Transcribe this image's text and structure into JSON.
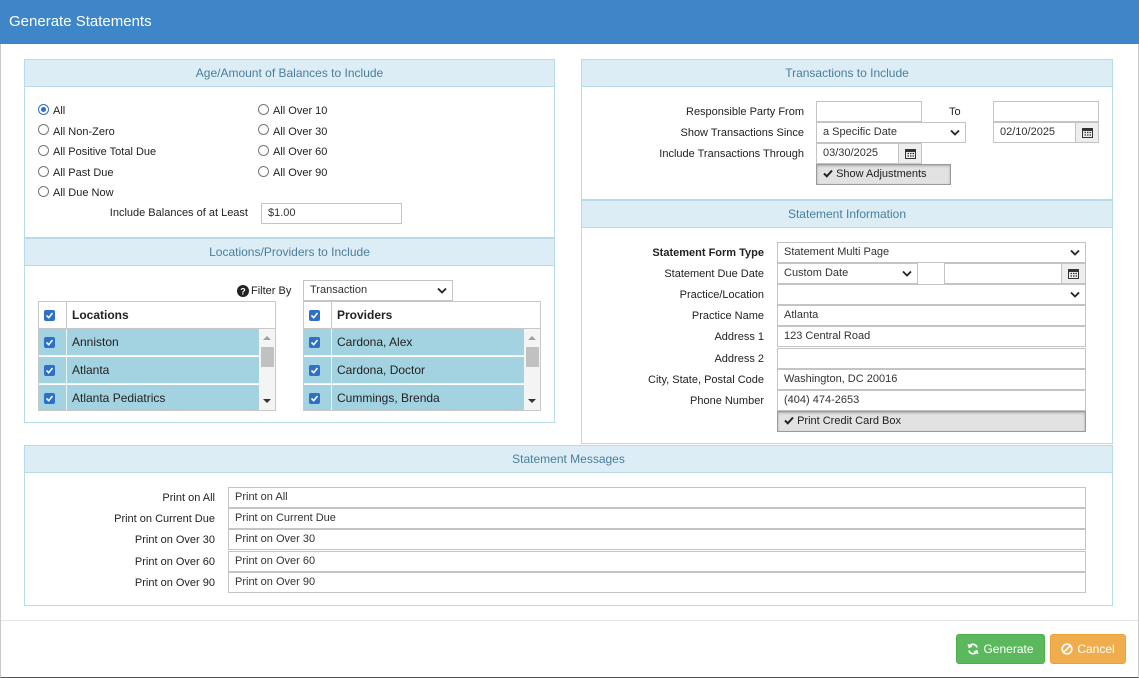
{
  "title": "Generate Statements",
  "age_panel": {
    "heading": "Age/Amount of Balances to Include",
    "options_left": [
      "All",
      "All Non-Zero",
      "All Positive Total Due",
      "All Past Due",
      "All Due Now"
    ],
    "options_right": [
      "All Over 10",
      "All Over 30",
      "All Over 60",
      "All Over 90"
    ],
    "selected": "All",
    "include_label": "Include Balances of at Least",
    "include_value": "$1.00"
  },
  "loc_panel": {
    "heading": "Locations/Providers to Include",
    "filter_label": "Filter By",
    "filter_value": "Transaction",
    "locations_header": "Locations",
    "locations": [
      "Anniston",
      "Atlanta",
      "Atlanta Pediatrics"
    ],
    "providers_header": "Providers",
    "providers": [
      "Cardona, Alex",
      "Cardona, Doctor",
      "Cummings, Brenda"
    ]
  },
  "trans_panel": {
    "heading": "Transactions to Include",
    "resp_from_label": "Responsible Party From",
    "resp_from_value": "",
    "to_label": "To",
    "to_value": "",
    "since_label": "Show Transactions Since",
    "since_option": "a Specific Date",
    "since_date": "02/10/2025",
    "through_label": "Include Transactions Through",
    "through_date": "03/30/2025",
    "adjustments_label": "Show Adjustments"
  },
  "stmt_panel": {
    "heading": "Statement Information",
    "form_type_label": "Statement Form Type",
    "form_type_value": "Statement Multi Page",
    "due_date_label": "Statement Due Date",
    "due_date_option": "Custom Date",
    "due_date_value": "",
    "practice_location_label": "Practice/Location",
    "practice_location_value": "",
    "practice_name_label": "Practice Name",
    "practice_name_value": "Atlanta",
    "address1_label": "Address 1",
    "address1_value": "123 Central Road",
    "address2_label": "Address 2",
    "address2_value": "",
    "city_label": "City, State, Postal Code",
    "city_value": "Washington, DC 20016",
    "phone_label": "Phone Number",
    "phone_value": "(404) 474-2653",
    "credit_card_label": "Print Credit Card Box"
  },
  "msg_panel": {
    "heading": "Statement Messages",
    "rows": [
      {
        "label": "Print on All",
        "value": "Print on All"
      },
      {
        "label": "Print on Current Due",
        "value": "Print on Current Due"
      },
      {
        "label": "Print on Over 30",
        "value": "Print on Over 30"
      },
      {
        "label": "Print on Over 60",
        "value": "Print on Over 60"
      },
      {
        "label": "Print on Over 90",
        "value": "Print on Over 90"
      }
    ]
  },
  "buttons": {
    "generate": "Generate",
    "cancel": "Cancel"
  },
  "colors": {
    "title_bar": "#3e86c8",
    "panel_header": "#dcedf5",
    "selected_row": "#a3d2e0",
    "generate": "#5cb85c",
    "cancel": "#f0ad4e"
  }
}
